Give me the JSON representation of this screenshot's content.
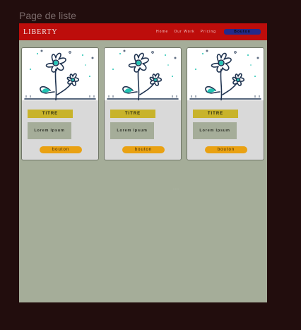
{
  "page_label": "Page de liste",
  "navbar": {
    "brand": "LIBERTY",
    "links": [
      "Home",
      "Our Work",
      "Pricing"
    ],
    "button_label": "Bouton"
  },
  "cards": [
    {
      "image_icon": "flower-illustration-icon",
      "title": "TITRE",
      "text": "Lorem Ipsum",
      "button_label": "bouton"
    },
    {
      "image_icon": "flower-illustration-icon",
      "title": "TITRE",
      "text": "Lorem Ipsum",
      "button_label": "bouton"
    },
    {
      "image_icon": "flower-illustration-icon",
      "title": "TITRE",
      "text": "Lorem Ipsum",
      "button_label": "bouton"
    }
  ],
  "center_dots": "···",
  "colors": {
    "background": "#220d0d",
    "frame": "#a5ad99",
    "navbar": "#bd0d0b",
    "nav_button": "#232a8a",
    "card_title": "#c8b32b",
    "card_button": "#e9a112",
    "illustration_teal": "#22c3b3",
    "illustration_navy": "#1f3350"
  }
}
